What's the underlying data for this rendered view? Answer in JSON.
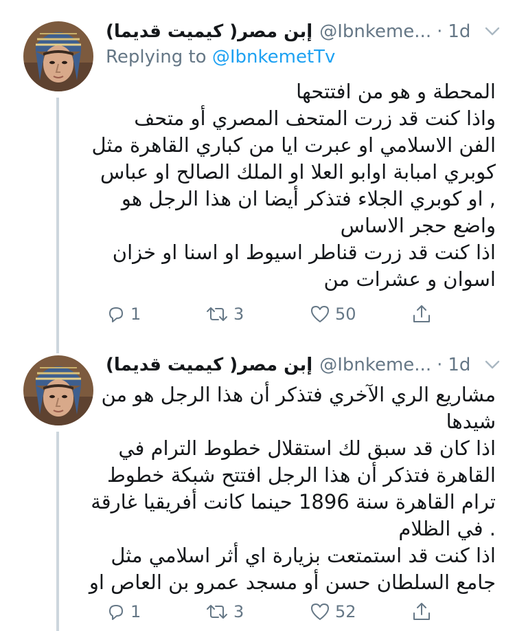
{
  "colors": {
    "accent": "#1da1f2",
    "muted": "#657786",
    "text": "#14171a",
    "thread_line": "#cdd6dd"
  },
  "tweets": [
    {
      "display_name": "إبن مصر( كيميت قديما)",
      "handle": "@Ibnkeme...",
      "separator": "·",
      "time": "1d",
      "replying_prefix": "Replying to",
      "replying_to": "@IbnkemetTv",
      "lines": [
        "المحطة و هو من افتتحها",
        "واذا كنت قد زرت المتحف المصري أو متحف",
        "الفن الاسلامي او عبرت ايا من كباري القاهرة مثل",
        "كوبري امبابة اوابو العلا او الملك الصالح او عباس",
        ", او كوبري الجلاء فتذكر أيضا ان هذا الرجل هو",
        "واضع حجر الاساس",
        "اذا كنت قد زرت قناطر اسيوط او اسنا او خزان",
        "اسوان و عشرات من"
      ],
      "replies": "1",
      "retweets": "3",
      "likes": "50"
    },
    {
      "display_name": "إبن مصر( كيميت قديما)",
      "handle": "@Ibnkeme...",
      "separator": "·",
      "time": "1d",
      "lines": [
        "مشاريع الري الآخري فتذكر أن هذا الرجل هو من",
        "شيدها",
        "اذا كان قد سبق لك استقلال خطوط الترام في",
        "القاهرة فتذكر أن هذا الرجل افتتح شبكة خطوط",
        "ترام القاهرة سنة 1896 حينما كانت أفريقيا غارقة",
        ". في الظلام",
        "اذا كنت قد استمتعت بزيارة اي أثر اسلامي مثل",
        "جامع السلطان حسن أو مسجد عمرو بن العاص او"
      ],
      "replies": "1",
      "retweets": "3",
      "likes": "52"
    }
  ]
}
